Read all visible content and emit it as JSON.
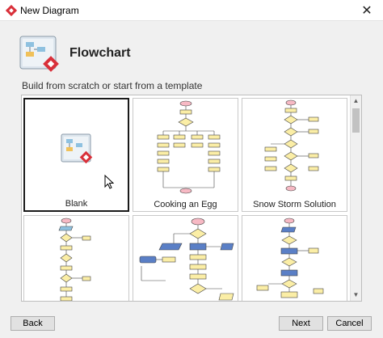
{
  "window": {
    "title": "New Diagram",
    "close_glyph": "✕",
    "icon": "visual-paradigm-icon"
  },
  "header": {
    "title": "Flowchart",
    "icon": "flowchart-diagram-icon"
  },
  "subtitle": "Build from scratch or start from a template",
  "templates": [
    {
      "label": "Blank",
      "selected": true
    },
    {
      "label": "Cooking an Egg",
      "selected": false
    },
    {
      "label": "Snow Storm Solution",
      "selected": false
    },
    {
      "label": "",
      "selected": false
    },
    {
      "label": "",
      "selected": false
    },
    {
      "label": "",
      "selected": false
    }
  ],
  "buttons": {
    "back": "Back",
    "next": "Next",
    "cancel": "Cancel"
  },
  "colors": {
    "accent_red": "#d9303a",
    "flow_yellow": "#fbeea6",
    "flow_pink": "#f7b9c4",
    "flow_blue": "#5a7fc6"
  }
}
